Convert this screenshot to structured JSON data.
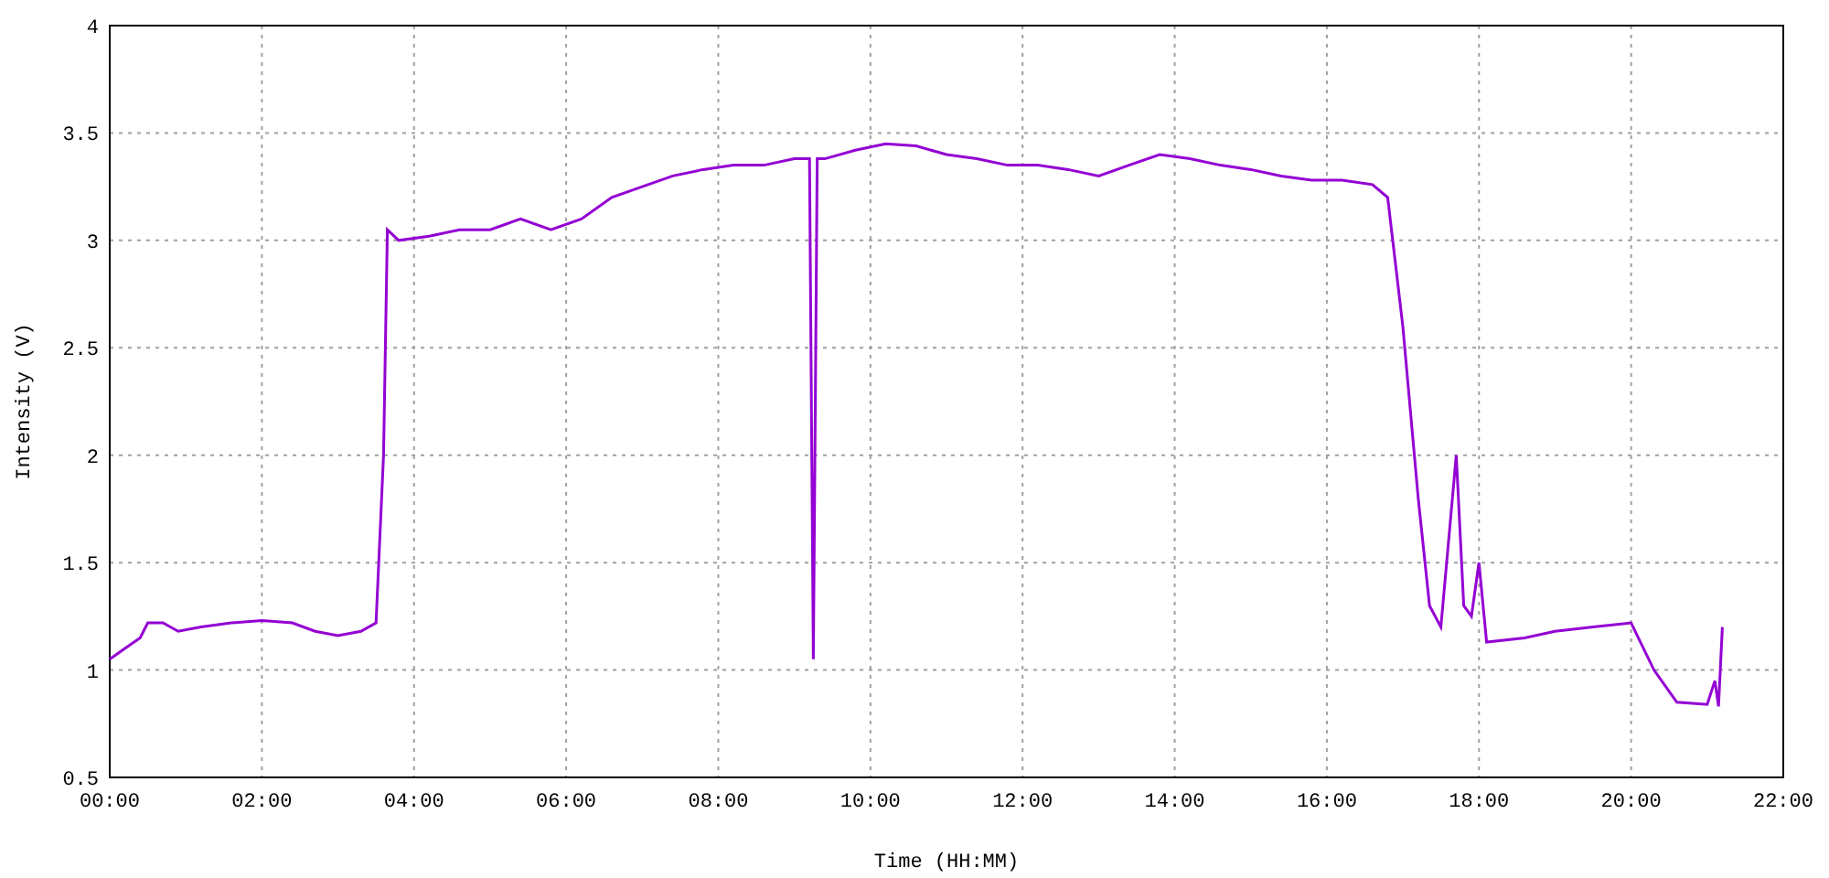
{
  "chart": {
    "chart_data": {
      "type": "line",
      "xlabel": "Time (HH:MM)",
      "ylabel": "Intensity (V)",
      "grid": true,
      "xlim": [
        0,
        22
      ],
      "ylim": [
        0.5,
        4
      ],
      "xticks": [
        {
          "value": 0,
          "label": "00:00"
        },
        {
          "value": 2,
          "label": "02:00"
        },
        {
          "value": 4,
          "label": "04:00"
        },
        {
          "value": 6,
          "label": "06:00"
        },
        {
          "value": 8,
          "label": "08:00"
        },
        {
          "value": 10,
          "label": "10:00"
        },
        {
          "value": 12,
          "label": "12:00"
        },
        {
          "value": 14,
          "label": "14:00"
        },
        {
          "value": 16,
          "label": "16:00"
        },
        {
          "value": 18,
          "label": "18:00"
        },
        {
          "value": 20,
          "label": "20:00"
        },
        {
          "value": 22,
          "label": "22:00"
        }
      ],
      "yticks": [
        0.5,
        1,
        1.5,
        2,
        2.5,
        3,
        3.5,
        4
      ],
      "x": [
        0,
        0.2,
        0.4,
        0.5,
        0.7,
        0.9,
        1.2,
        1.6,
        2.0,
        2.4,
        2.7,
        3.0,
        3.3,
        3.5,
        3.6,
        3.65,
        3.8,
        4.2,
        4.6,
        5.0,
        5.4,
        5.8,
        6.2,
        6.6,
        7.0,
        7.4,
        7.8,
        8.2,
        8.6,
        9.0,
        9.2,
        9.25,
        9.3,
        9.4,
        9.8,
        10.2,
        10.6,
        11.0,
        11.4,
        11.8,
        12.2,
        12.6,
        13.0,
        13.4,
        13.8,
        14.2,
        14.6,
        15.0,
        15.4,
        15.8,
        16.2,
        16.6,
        16.8,
        17.0,
        17.2,
        17.35,
        17.5,
        17.7,
        17.8,
        17.9,
        18.0,
        18.1,
        18.6,
        19.0,
        19.5,
        20.0,
        20.3,
        20.6,
        21.0,
        21.1,
        21.15,
        21.2
      ],
      "series": [
        {
          "color": "#9400d3",
          "values": [
            1.05,
            1.1,
            1.15,
            1.22,
            1.22,
            1.18,
            1.2,
            1.22,
            1.23,
            1.22,
            1.18,
            1.16,
            1.18,
            1.22,
            2.0,
            3.05,
            3.0,
            3.02,
            3.05,
            3.05,
            3.1,
            3.05,
            3.1,
            3.2,
            3.25,
            3.3,
            3.33,
            3.35,
            3.35,
            3.38,
            3.38,
            1.05,
            3.38,
            3.38,
            3.42,
            3.45,
            3.44,
            3.4,
            3.38,
            3.35,
            3.35,
            3.33,
            3.3,
            3.35,
            3.4,
            3.38,
            3.35,
            3.33,
            3.3,
            3.28,
            3.28,
            3.26,
            3.2,
            2.6,
            1.8,
            1.3,
            1.2,
            2.0,
            1.3,
            1.25,
            1.5,
            1.13,
            1.15,
            1.18,
            1.2,
            1.22,
            1.0,
            0.85,
            0.84,
            0.95,
            0.83,
            1.2
          ]
        }
      ]
    }
  }
}
